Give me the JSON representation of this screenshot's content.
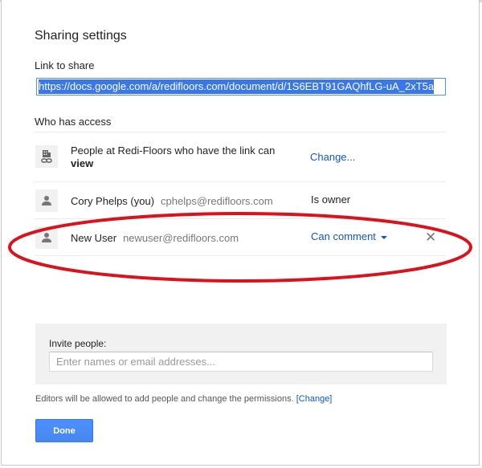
{
  "dialog": {
    "title": "Sharing settings",
    "link_label": "Link to share",
    "link_url": "https://docs.google.com/a/redifloors.com/document/d/1S6EBT91GAQhfLG-uA_2xT5a",
    "access_label": "Who has access"
  },
  "access_rows": [
    {
      "icon": "building-link-icon",
      "text_before": "People at Redi-Floors who have the link can",
      "text_bold": "view",
      "action": "Change..."
    },
    {
      "icon": "person-icon",
      "name": "Cory Phelps (you)",
      "email": "cphelps@redifloors.com",
      "role": "Is owner"
    },
    {
      "icon": "person-icon",
      "name": "New User",
      "email": "newuser@redifloors.com",
      "role": "Can comment",
      "remove": "✕"
    }
  ],
  "invite": {
    "label": "Invite people:",
    "placeholder": "Enter names or email addresses..."
  },
  "footer": {
    "note": "Editors will be allowed to add people and change the permissions.",
    "change_link": "[Change]",
    "done_label": "Done"
  },
  "colors": {
    "accent_blue": "#4d90fe",
    "link_blue": "#1155cc",
    "annotation_red": "#d9121b"
  }
}
